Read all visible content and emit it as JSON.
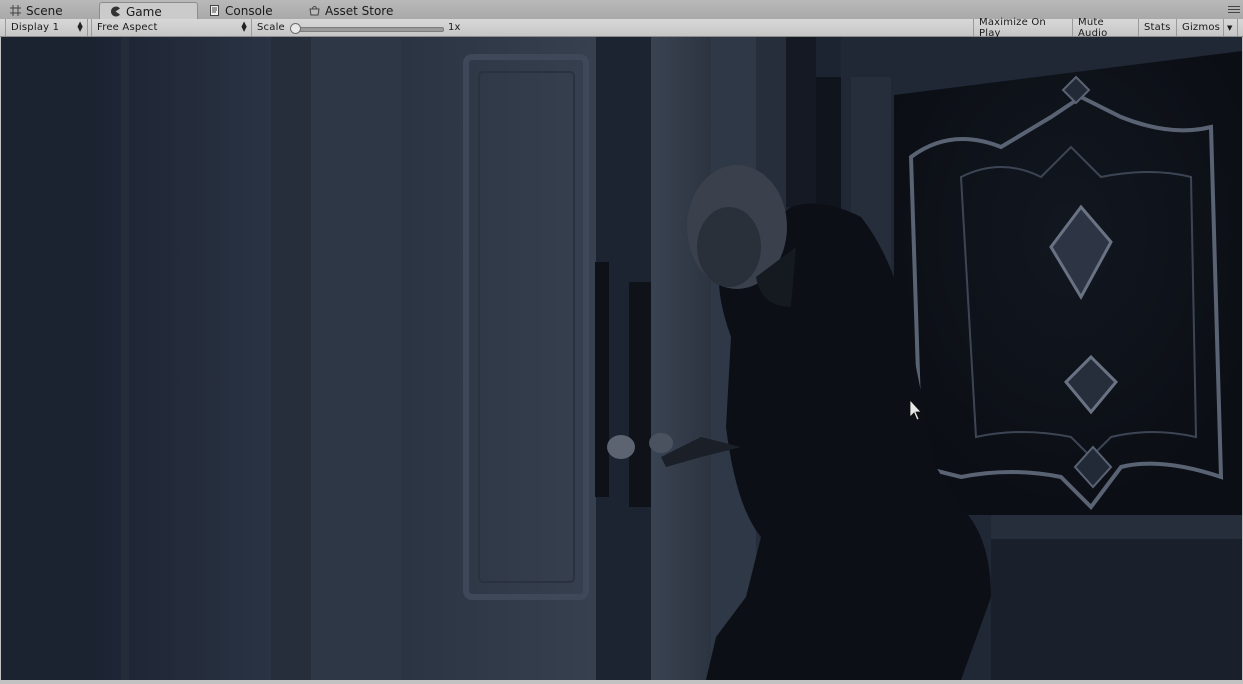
{
  "tabs": [
    {
      "label": "Scene",
      "icon": "scene-grid-icon"
    },
    {
      "label": "Game",
      "icon": "pacman-icon",
      "active": true
    },
    {
      "label": "Console",
      "icon": "console-icon"
    },
    {
      "label": "Asset Store",
      "icon": "asset-store-icon"
    }
  ],
  "toolbar": {
    "display": "Display 1",
    "aspect": "Free Aspect",
    "scale_label": "Scale",
    "scale_value": "1x",
    "maximize_on_play": "Maximize On Play",
    "mute_audio": "Mute Audio",
    "stats": "Stats",
    "gizmos": "Gizmos"
  },
  "colors": {
    "tab_bar": "#b0b0b0",
    "toolbar": "#cecece",
    "game_tint": "#1b2230"
  }
}
